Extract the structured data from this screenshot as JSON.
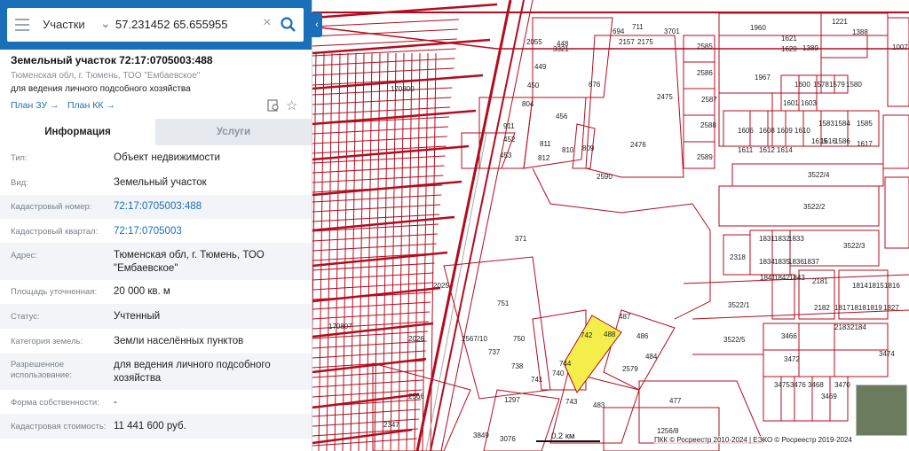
{
  "search": {
    "type_label": "Участки",
    "query": "57.231452 65.655955"
  },
  "parcel": {
    "title": "Земельный участок 72:17:0705003:488",
    "address_short": "Тюменская обл, г. Тюмень, ТОО \"Ембаевское\"",
    "purpose": "для ведения личного подсобного хозяйства",
    "plan_zu": "План ЗУ →",
    "plan_kk": "План КК →"
  },
  "tabs": {
    "info": "Информация",
    "services": "Услуги"
  },
  "info_rows": [
    {
      "label": "Тип:",
      "value": "Объект недвижимости"
    },
    {
      "label": "Вид:",
      "value": "Земельный участок"
    },
    {
      "label": "Кадастровый номер:",
      "value": "72:17:0705003:488"
    },
    {
      "label": "Кадастровый квартал:",
      "value": "72:17:0705003"
    },
    {
      "label": "Адрес:",
      "value": "Тюменская обл, г. Тюмень, ТОО \"Ембаевское\""
    },
    {
      "label": "Площадь уточненная:",
      "value": "20 000 кв. м"
    },
    {
      "label": "Статус:",
      "value": "Учтенный"
    },
    {
      "label": "Категория земель:",
      "value": "Земли населённых пунктов"
    },
    {
      "label": "Разрешенное использование:",
      "value": "для ведения личного подсобного хозяйства"
    },
    {
      "label": "Форма собственности:",
      "value": "-"
    },
    {
      "label": "Кадастровая стоимость:",
      "value": "11 441 600 руб."
    }
  ],
  "map": {
    "labels": [
      "1960",
      "1221",
      "1388",
      "1389",
      "1007",
      "1621",
      "1620",
      "3701",
      "2585",
      "2586",
      "2587",
      "2588",
      "2589",
      "2475",
      "2476",
      "2590",
      "1967",
      "1600",
      "1578",
      "1579",
      "1580",
      "1601",
      "1603",
      "1606",
      "1608",
      "1609",
      "1610",
      "1611",
      "1612",
      "1614",
      "1583",
      "1584",
      "1585",
      "1586",
      "1617",
      "1615",
      "1616",
      "3522/4",
      "3522/2",
      "3522/3",
      "3522/1",
      "3522/5",
      "371",
      "2318",
      "1831",
      "1832",
      "1833",
      "1834",
      "1835",
      "1836",
      "1837",
      "1842",
      "1841",
      "1843",
      "2181",
      "2182",
      "1814",
      "1815",
      "1816",
      "1817",
      "1818",
      "1819",
      "1827",
      "2183",
      "2184",
      "3466",
      "3472",
      "3474",
      "3475",
      "3476",
      "3468",
      "3469",
      "3470",
      "448",
      "449",
      "450",
      "804",
      "911",
      "452",
      "453",
      "456",
      "676",
      "811",
      "812",
      "810",
      "809",
      "2055",
      "3321",
      "694",
      "711",
      "2157",
      "2175",
      "170800",
      "170807",
      "2025",
      "2026",
      "2567/10",
      "751",
      "750",
      "737",
      "738",
      "741",
      "740",
      "743",
      "744",
      "742",
      "486",
      "487",
      "488",
      "484",
      "2579",
      "483",
      "477",
      "1297",
      "2566",
      "3076",
      "1256/8",
      "2347",
      "3849"
    ],
    "scale": "0.2 км",
    "attribution": "ПКК © Росреестр 2010-2024 | ЕЭКО © Росреестр 2019-2024",
    "parcel_color": "#f3ee4a",
    "line_color": "#b30c1e"
  }
}
